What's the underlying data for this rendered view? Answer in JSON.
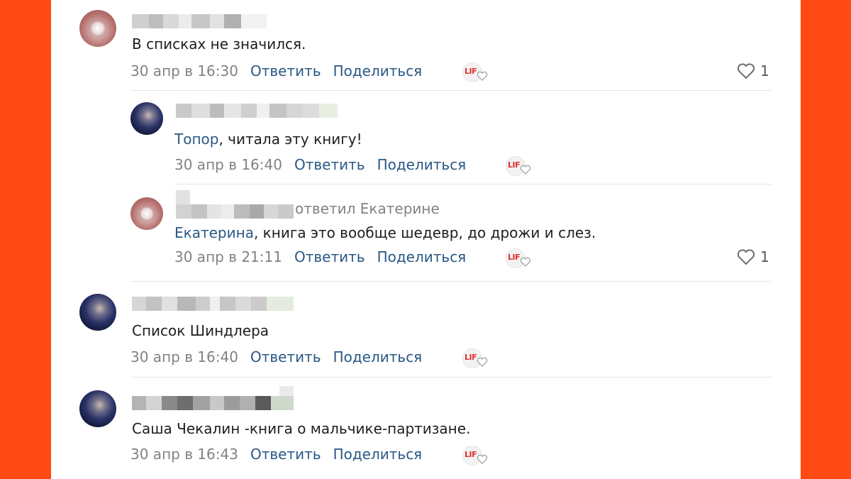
{
  "colors": {
    "frame": "#ff4a14",
    "link": "#2a5885",
    "meta": "#828282",
    "text": "#1e1e1e"
  },
  "labels": {
    "reply": "Ответить",
    "share": "Поделиться",
    "reaction_badge": "LIF"
  },
  "comments": [
    {
      "name": "",
      "mention": "",
      "text": "В списках не значился.",
      "date": "30 апр в 16:30",
      "likes": "1",
      "avatar_icon": "avatar-pink-icon"
    },
    {
      "name": "",
      "mention": "Топор",
      "text": ", читала эту книгу!",
      "date": "30 апр в 16:40",
      "likes": "",
      "avatar_icon": "avatar-blue-icon"
    },
    {
      "name": "",
      "reply_to": "ответил Екатерине",
      "mention": "Екатерина",
      "text": ", книга это вообще шедевр, до дрожи и слез.",
      "date": "30 апр в 21:11",
      "likes": "1",
      "avatar_icon": "avatar-pink-icon"
    },
    {
      "name": "",
      "mention": "",
      "text": "Список Шиндлера",
      "date": "30 апр в 16:40",
      "likes": "",
      "avatar_icon": "avatar-blue-icon"
    },
    {
      "name": "",
      "mention": "",
      "text": "Саша Чекалин -книга о мальчике-партизане.",
      "date": "30 апр в 16:43",
      "likes": "",
      "avatar_icon": "avatar-blue-icon"
    }
  ]
}
